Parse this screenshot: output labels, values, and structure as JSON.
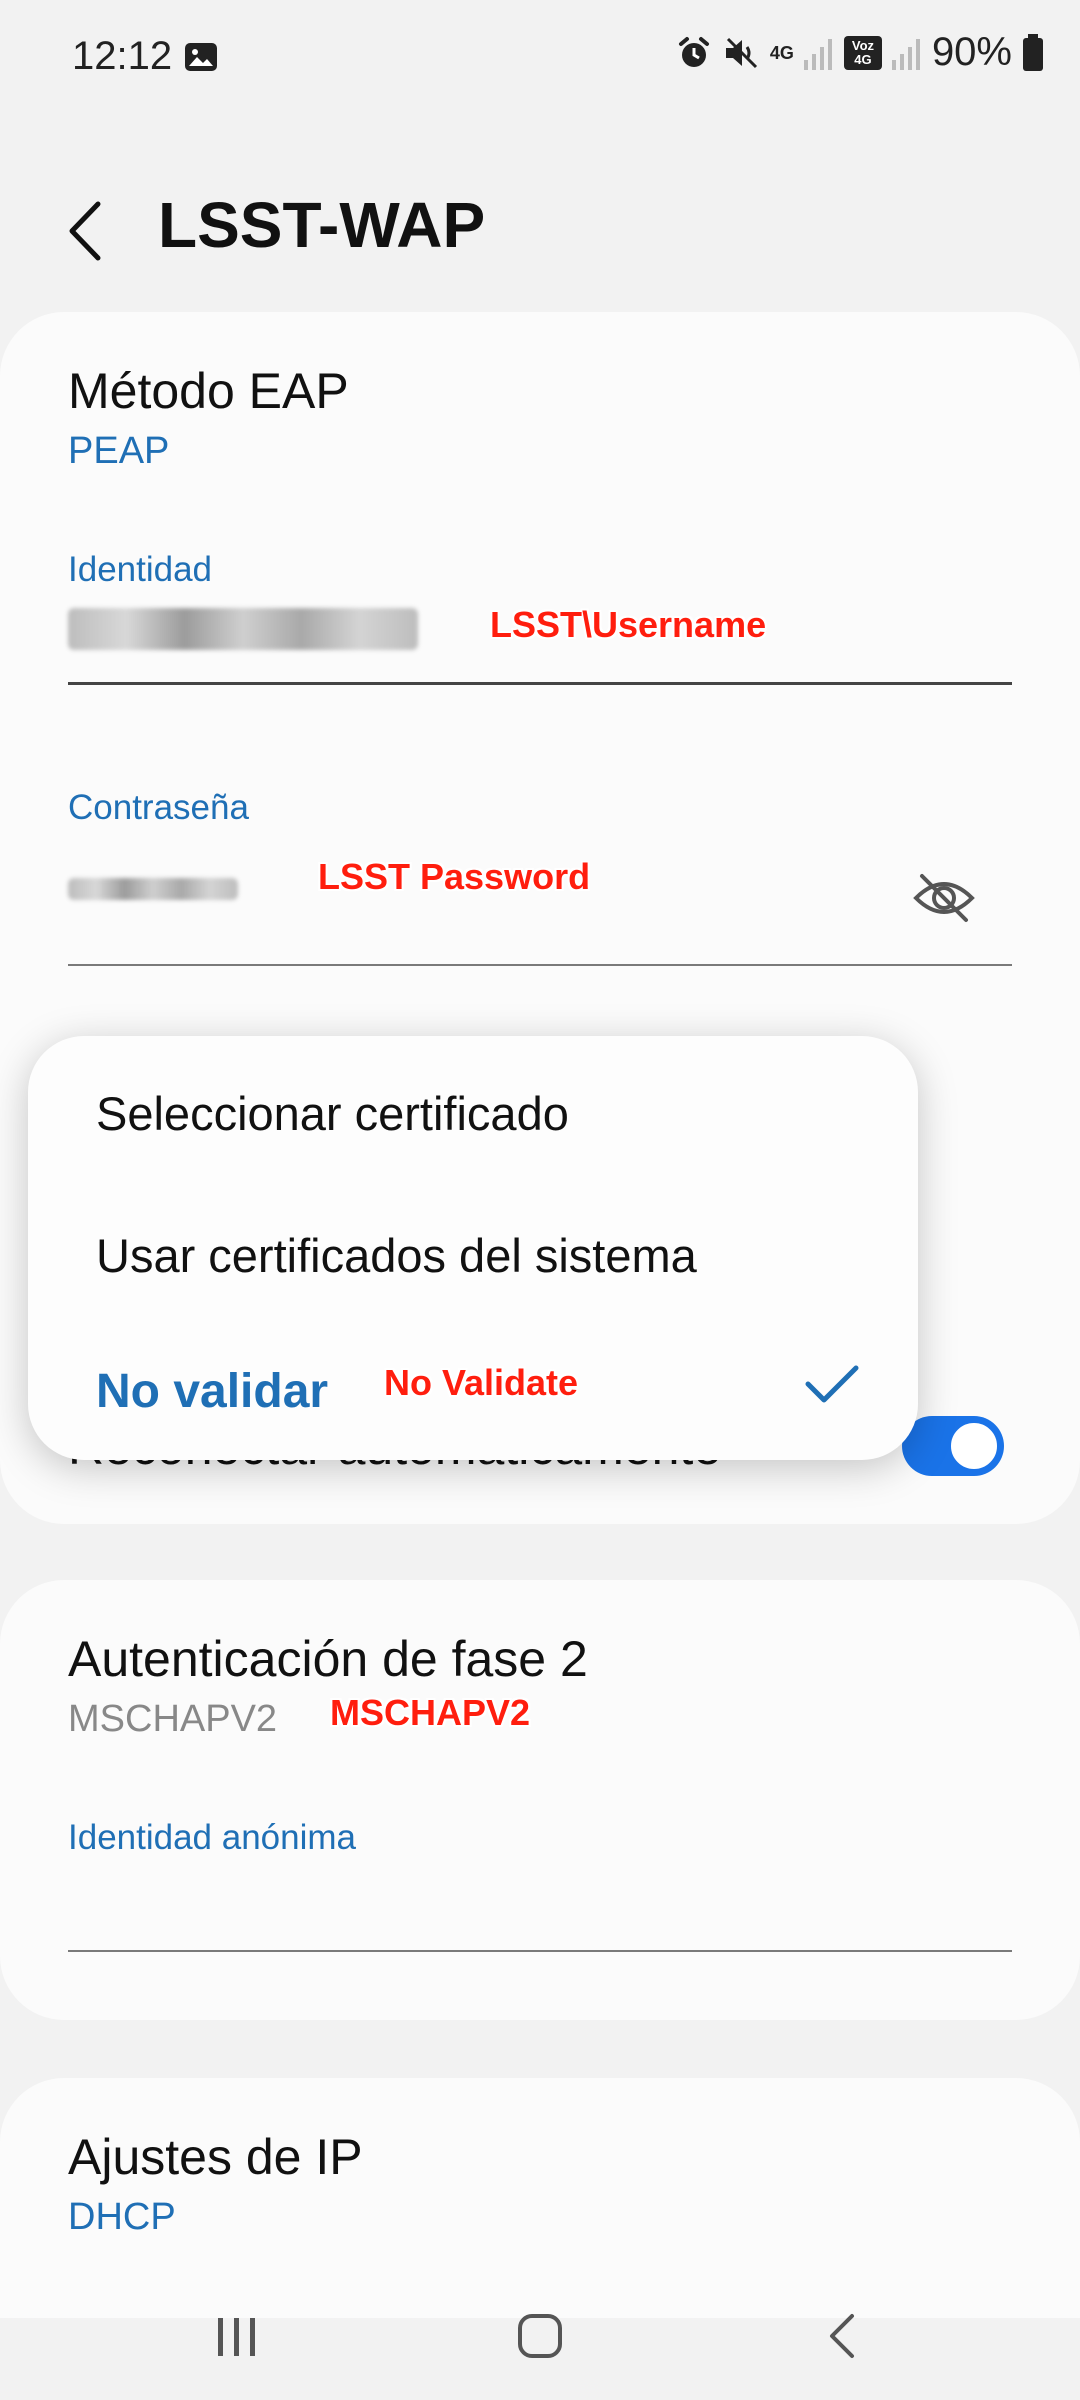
{
  "status_bar": {
    "time": "12:12",
    "battery": "90%",
    "network_label": "4G",
    "volte_label": "Voz 4G"
  },
  "header": {
    "title": "LSST-WAP"
  },
  "eap": {
    "label": "Método EAP",
    "value": "PEAP"
  },
  "identity": {
    "label": "Identidad",
    "annotation": "LSST\\Username"
  },
  "password": {
    "label": "Contraseña",
    "annotation": "LSST Password"
  },
  "popup": {
    "options": [
      "Seleccionar certificado",
      "Usar certificados del sistema",
      "No validar"
    ],
    "selected_index": 2,
    "annotation": "No Validate"
  },
  "reconnect": {
    "label": "Reconectar automáticamente",
    "enabled": true
  },
  "phase2": {
    "label": "Autenticación de fase 2",
    "value": "MSCHAPV2",
    "annotation": "MSCHAPV2"
  },
  "anon_identity": {
    "label": "Identidad anónima"
  },
  "ip": {
    "label": "Ajustes de IP",
    "value": "DHCP"
  },
  "colors": {
    "accent": "#1f6fb5",
    "toggle": "#1a73e8",
    "annotation": "#ff1e0e"
  },
  "icons": [
    "gallery-icon",
    "alarm-icon",
    "mute-icon",
    "signal-icon",
    "battery-icon",
    "back-arrow-icon",
    "eye-off-icon",
    "checkmark-icon",
    "recents-icon",
    "home-icon",
    "nav-back-icon"
  ]
}
